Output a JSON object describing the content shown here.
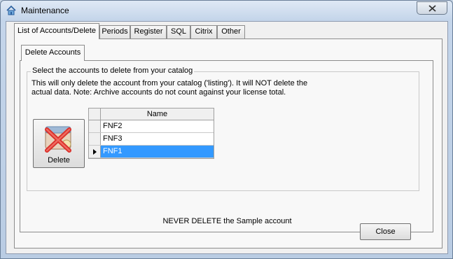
{
  "window": {
    "title": "Maintenance",
    "icon": "house-icon"
  },
  "tabs": [
    {
      "label": "List of Accounts/Delete",
      "active": true
    },
    {
      "label": "Periods",
      "active": false
    },
    {
      "label": "Register",
      "active": false
    },
    {
      "label": "SQL",
      "active": false
    },
    {
      "label": "Citrix",
      "active": false
    },
    {
      "label": "Other",
      "active": false
    }
  ],
  "inner_tab": {
    "label": "Delete Accounts"
  },
  "group": {
    "legend": "Select the accounts to delete from your catalog",
    "description": "This will only delete the account from your catalog ('listing').  It will NOT delete the actual data. Note: Archive accounts do not count against your license total."
  },
  "delete_button": {
    "label": "Delete",
    "icon": "delete-account-icon"
  },
  "grid": {
    "header": "Name",
    "rows": [
      {
        "name": "FNF2",
        "selected": false
      },
      {
        "name": "FNF3",
        "selected": false
      },
      {
        "name": "FNF1",
        "selected": true
      }
    ]
  },
  "warning": "NEVER DELETE the Sample account",
  "close_button": {
    "label": "Close"
  },
  "colors": {
    "selection": "#3399ff",
    "frame": "#b9cce3"
  }
}
